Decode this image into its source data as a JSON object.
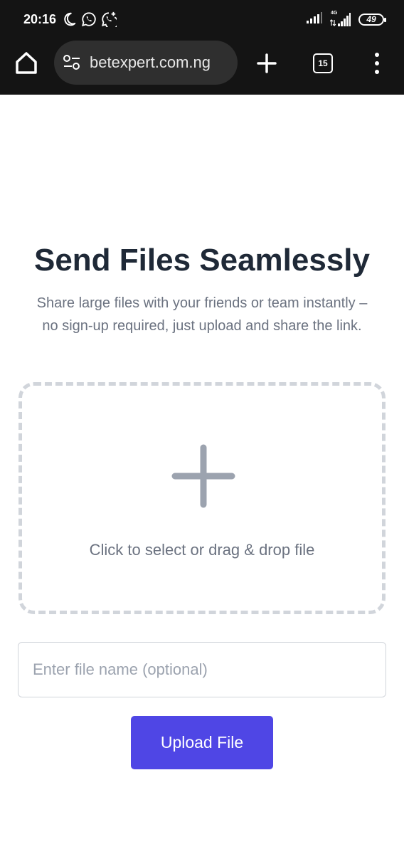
{
  "status_bar": {
    "time": "20:16",
    "network_label": "4G",
    "battery": "49"
  },
  "browser": {
    "url": "betexpert.com.ng",
    "tab_count": "15"
  },
  "page": {
    "title": "Send Files Seamlessly",
    "subtitle_line1": "Share large files with your friends or team instantly –",
    "subtitle_line2": "no sign-up required, just upload and share the link.",
    "dropzone_text": "Click to select or drag & drop file",
    "filename_placeholder": "Enter file name (optional)",
    "upload_label": "Upload File"
  },
  "colors": {
    "accent": "#4f46e5",
    "heading": "#1f2937",
    "muted_text": "#6b7280",
    "border": "#d1d5db"
  },
  "icons": {
    "status_left": [
      "moon-icon",
      "whatsapp-icon",
      "whatsapp-business-icon"
    ],
    "status_right": [
      "signal-icon",
      "signal-4g-icon",
      "battery-icon"
    ],
    "browser": [
      "home-icon",
      "site-settings-icon",
      "new-tab-icon",
      "tab-switcher-icon",
      "more-menu-icon"
    ],
    "dropzone": "plus-icon"
  }
}
